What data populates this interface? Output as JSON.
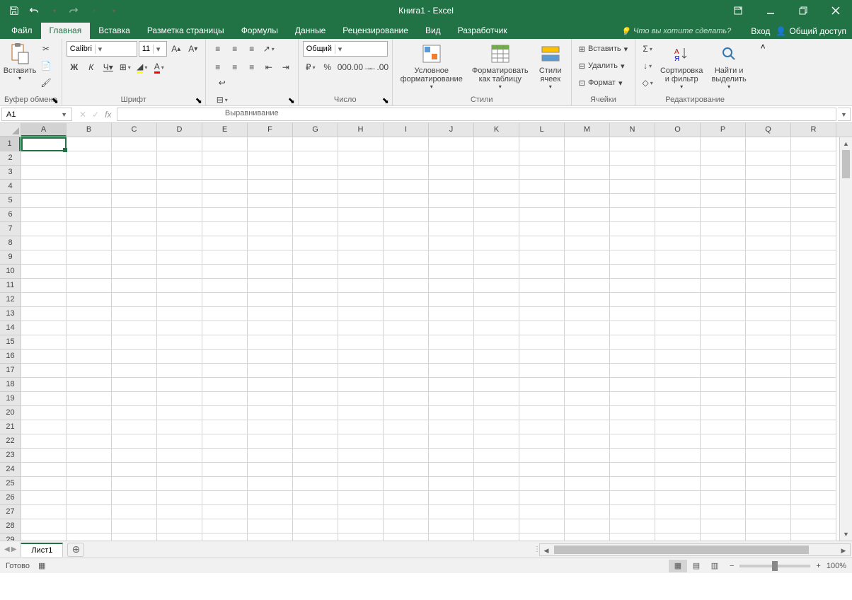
{
  "title": "Книга1 - Excel",
  "qat": {
    "save": "save",
    "undo": "undo",
    "redo": "redo"
  },
  "win": {
    "ribbon_opts": "ribbon-options",
    "min": "minimize",
    "max": "restore",
    "close": "close"
  },
  "tabs": {
    "file": "Файл",
    "home": "Главная",
    "insert": "Вставка",
    "page_layout": "Разметка страницы",
    "formulas": "Формулы",
    "data": "Данные",
    "review": "Рецензирование",
    "view": "Вид",
    "developer": "Разработчик"
  },
  "tell_me": "Что вы хотите сделать?",
  "login": "Вход",
  "share": "Общий доступ",
  "ribbon": {
    "clipboard": {
      "paste": "Вставить",
      "label": "Буфер обмена"
    },
    "font": {
      "name": "Calibri",
      "size": "11",
      "bold": "Ж",
      "italic": "К",
      "underline": "Ч",
      "label": "Шрифт"
    },
    "alignment": {
      "label": "Выравнивание"
    },
    "number": {
      "format": "Общий",
      "label": "Число"
    },
    "styles": {
      "cond": "Условное форматирование",
      "table": "Форматировать как таблицу",
      "cell": "Стили ячеек",
      "label": "Стили"
    },
    "cells": {
      "insert": "Вставить",
      "delete": "Удалить",
      "format": "Формат",
      "label": "Ячейки"
    },
    "editing": {
      "sort": "Сортировка и фильтр",
      "find": "Найти и выделить",
      "label": "Редактирование"
    }
  },
  "namebox": "A1",
  "columns": [
    "A",
    "B",
    "C",
    "D",
    "E",
    "F",
    "G",
    "H",
    "I",
    "J",
    "K",
    "L",
    "M",
    "N",
    "O",
    "P",
    "Q",
    "R"
  ],
  "rows": [
    1,
    2,
    3,
    4,
    5,
    6,
    7,
    8,
    9,
    10,
    11,
    12,
    13,
    14,
    15,
    16,
    17,
    18,
    19,
    20,
    21,
    22,
    23,
    24,
    25,
    26,
    27,
    28,
    29
  ],
  "sheet": "Лист1",
  "status": "Готово",
  "zoom": "100%"
}
